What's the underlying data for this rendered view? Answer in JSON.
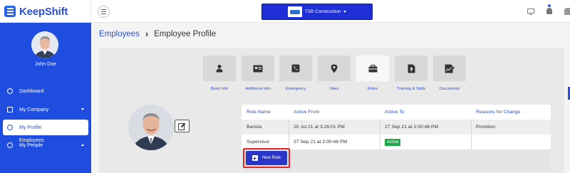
{
  "brand": {
    "name": "KeepShift"
  },
  "header": {
    "company": "TSB Construction"
  },
  "sidebar": {
    "user_name": "John Doe",
    "items": [
      {
        "label": "Dashboard",
        "icon": "dashboard-icon"
      },
      {
        "label": "My Company",
        "icon": "building-icon"
      },
      {
        "label": "My Profile",
        "icon": "user-icon"
      },
      {
        "label": "My People",
        "icon": "people-icon"
      }
    ],
    "sub_items": [
      {
        "label": "Employees"
      }
    ]
  },
  "breadcrumb": {
    "parent": "Employees",
    "current": "Employee Profile"
  },
  "tabs": [
    {
      "label": "Basic Info",
      "icon": "person-icon"
    },
    {
      "label": "Additional Info",
      "icon": "id-card-icon"
    },
    {
      "label": "Emergency",
      "icon": "phone-icon"
    },
    {
      "label": "Sites",
      "icon": "map-pin-icon"
    },
    {
      "label": "Roles",
      "icon": "briefcase-icon"
    },
    {
      "label": "Training & Skills",
      "icon": "upload-file-icon"
    },
    {
      "label": "Documents",
      "icon": "document-chart-icon"
    }
  ],
  "roles": {
    "columns": [
      "Role Name",
      "Active From",
      "Active To",
      "Reasons for Change"
    ],
    "rows": [
      {
        "role": "Barista",
        "from": "20 Jul 21 at 3:26:01 PM",
        "to": "27 Sep 21 at 2:00:48 PM",
        "reason": "Promtion"
      },
      {
        "role": "Supervisor",
        "from": "27 Sep 21 at 2:00:48 PM",
        "to": "Active",
        "reason": ""
      }
    ],
    "new_role_label": "New Role"
  },
  "colors": {
    "accent": "#2a4fd6",
    "sidebar": "#1f4de0",
    "active_badge": "#1ea84a",
    "highlight": "#e3262c"
  }
}
